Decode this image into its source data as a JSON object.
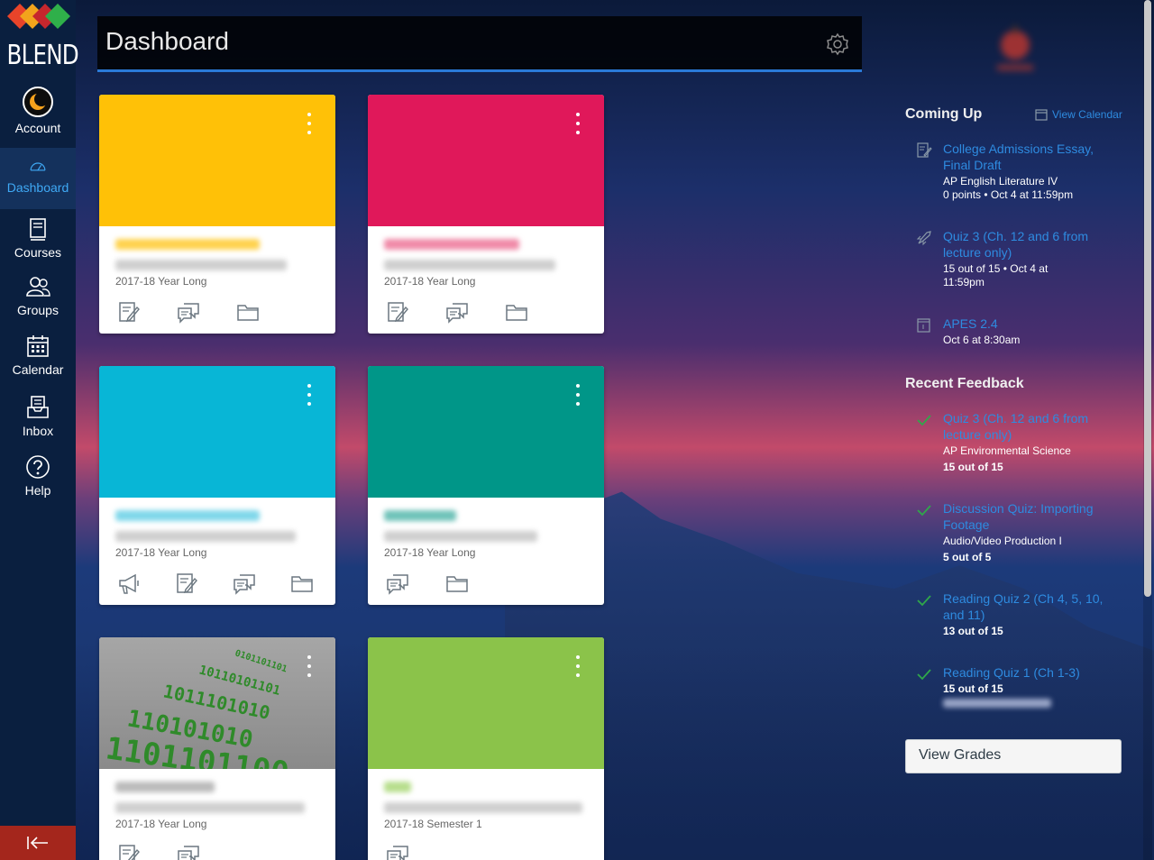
{
  "sidebar": {
    "logo_text": "BLEND",
    "items": [
      {
        "label": "Account"
      },
      {
        "label": "Dashboard"
      },
      {
        "label": "Courses"
      },
      {
        "label": "Groups"
      },
      {
        "label": "Calendar"
      },
      {
        "label": "Inbox"
      },
      {
        "label": "Help"
      }
    ]
  },
  "header": {
    "title": "Dashboard"
  },
  "colors": {
    "card_yellow": "#ffc107",
    "card_pink": "#e0185a",
    "card_cyan": "#08b6d6",
    "card_teal": "#009688",
    "card_gray": "#8c8c8c",
    "card_green": "#8bc34a",
    "link": "#2e8be0",
    "sidebar": "#0a1f3f"
  },
  "cards": [
    {
      "term": "2017-18 Year Long"
    },
    {
      "term": "2017-18 Year Long"
    },
    {
      "term": "2017-18 Year Long"
    },
    {
      "term": "2017-18 Year Long"
    },
    {
      "term": "2017-18 Year Long"
    },
    {
      "term": "2017-18 Semester 1"
    }
  ],
  "coming_up": {
    "heading": "Coming Up",
    "view_calendar": "View Calendar",
    "items": [
      {
        "title": "College Admissions Essay, Final Draft",
        "course": "AP English Literature IV",
        "details": "0 points • Oct 4 at 11:59pm",
        "icon": "assignment-icon"
      },
      {
        "title": "Quiz 3 (Ch. 12 and 6 from lecture only)",
        "details": "15 out of 15 • Oct 4 at 11:59pm",
        "icon": "quiz-rocket-icon"
      },
      {
        "title": "APES 2.4",
        "details": "Oct 6 at 8:30am",
        "icon": "calendar-event-icon"
      }
    ]
  },
  "recent_feedback": {
    "heading": "Recent Feedback",
    "items": [
      {
        "title": "Quiz 3 (Ch. 12 and 6 from lecture only)",
        "course": "AP Environmental Science",
        "score": "15 out of 15"
      },
      {
        "title": "Discussion Quiz: Importing Footage",
        "course": "Audio/Video Production I",
        "score": "5 out of 5"
      },
      {
        "title": "Reading Quiz 2 (Ch 4, 5, 10, and 11)",
        "score": "13 out of 15"
      },
      {
        "title": "Reading Quiz 1 (Ch 1-3)",
        "score": "15 out of 15"
      }
    ]
  },
  "view_grades": "View Grades"
}
